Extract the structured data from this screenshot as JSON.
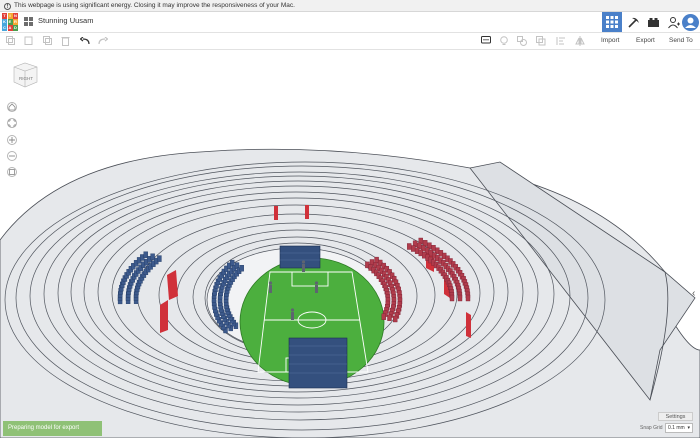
{
  "energy_bar": {
    "message": "This webpage is using significant energy. Closing it may improve the responsiveness of your Mac."
  },
  "app": {
    "logo_letters": [
      "T",
      "I",
      "N",
      "K",
      "E",
      "R",
      "C",
      "A",
      "D"
    ],
    "logo_colors": [
      "#e2403a",
      "#f6a733",
      "#e2403a",
      "#47a7dc",
      "#4a9e4e",
      "#f6a733",
      "#47a7dc",
      "#e2403a",
      "#4a9e4e"
    ],
    "design_title": "Stunning Uusam"
  },
  "toolbar": {
    "import_label": "Import",
    "export_label": "Export",
    "send_to_label": "Send To"
  },
  "view_cube": {
    "face_label": "RIGHT"
  },
  "status": {
    "message": "Preparing model for export"
  },
  "bottom_right": {
    "settings_label": "Settings",
    "snap_grid_label": "Snap Grid",
    "snap_grid_value": "0.1 mm"
  },
  "colors": {
    "accent": "#4a80c9",
    "field": "#4caf3e",
    "seats_blue": "#3d5a8c",
    "seats_red": "#b03c4c"
  }
}
